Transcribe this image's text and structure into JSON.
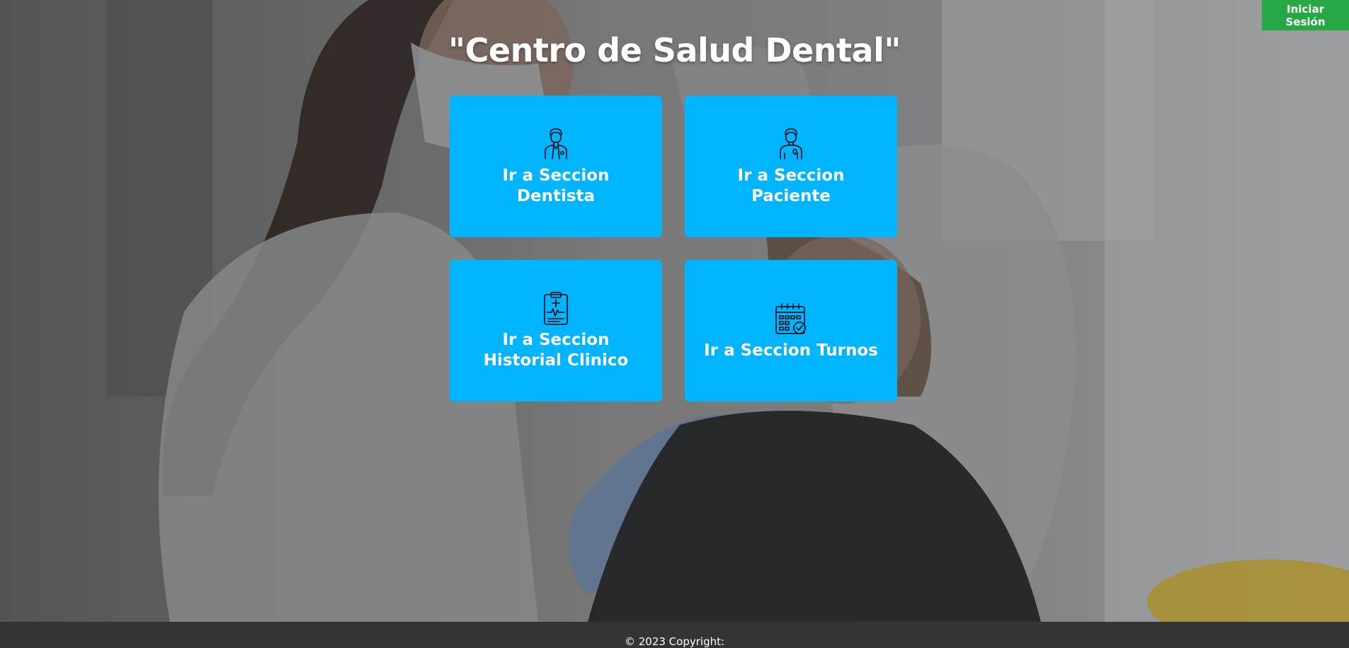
{
  "header": {
    "title": "\"Centro de Salud Dental\"",
    "login_label": "Iniciar Sesión"
  },
  "cards": [
    {
      "label": "Ir a Seccion Dentista",
      "icon": "dentist-icon"
    },
    {
      "label": "Ir a Seccion Paciente",
      "icon": "patient-icon"
    },
    {
      "label": "Ir a Seccion Historial Clinico",
      "icon": "clipboard-icon"
    },
    {
      "label": "Ir a Seccion Turnos",
      "icon": "calendar-check-icon"
    }
  ],
  "footer": {
    "copyright": "© 2023 Copyright:"
  },
  "colors": {
    "card": "#00b4ff",
    "login": "#28a745",
    "footer": "#343434"
  }
}
